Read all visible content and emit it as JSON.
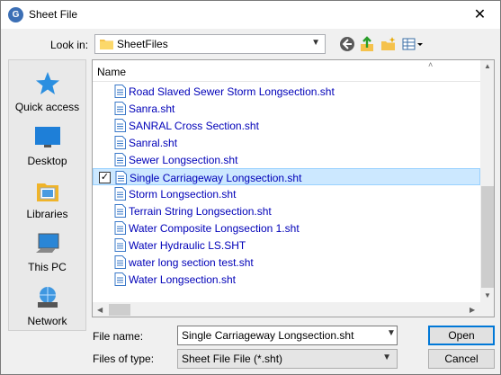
{
  "window": {
    "title": "Sheet File",
    "app_icon_glyph": "G",
    "close_glyph": "✕"
  },
  "toolbar": {
    "lookin_label": "Look in:",
    "lookin_value": "SheetFiles",
    "dropdown_glyph": "⌵"
  },
  "places": [
    {
      "label": "Quick access",
      "icon": "quick-access-star-icon"
    },
    {
      "label": "Desktop",
      "icon": "desktop-icon"
    },
    {
      "label": "Libraries",
      "icon": "libraries-icon"
    },
    {
      "label": "This PC",
      "icon": "this-pc-icon"
    },
    {
      "label": "Network",
      "icon": "network-icon"
    }
  ],
  "filelist": {
    "column_name": "Name",
    "sort_glyph": "˄",
    "files": [
      "Road Slaved Sewer Storm Longsection.sht",
      "Sanra.sht",
      "SANRAL Cross Section.sht",
      "Sanral.sht",
      "Sewer Longsection.sht",
      "Single Carriageway Longsection.sht",
      "Storm Longsection.sht",
      "Terrain String Longsection.sht",
      "Water Composite Longsection 1.sht",
      "Water Hydraulic LS.SHT",
      "water long section test.sht",
      "Water Longsection.sht"
    ],
    "selected_file": "Single Carriageway Longsection.sht",
    "check_glyph": "✓"
  },
  "form": {
    "filename_label": "File name:",
    "filename_value": "Single Carriageway Longsection.sht",
    "filetype_label": "Files of type:",
    "filetype_value": "Sheet File File (*.sht)",
    "open_label": "Open",
    "cancel_label": "Cancel"
  },
  "colors": {
    "file_text": "#0000b8",
    "selection": "#cce8ff",
    "default_button_border": "#0078d7"
  }
}
